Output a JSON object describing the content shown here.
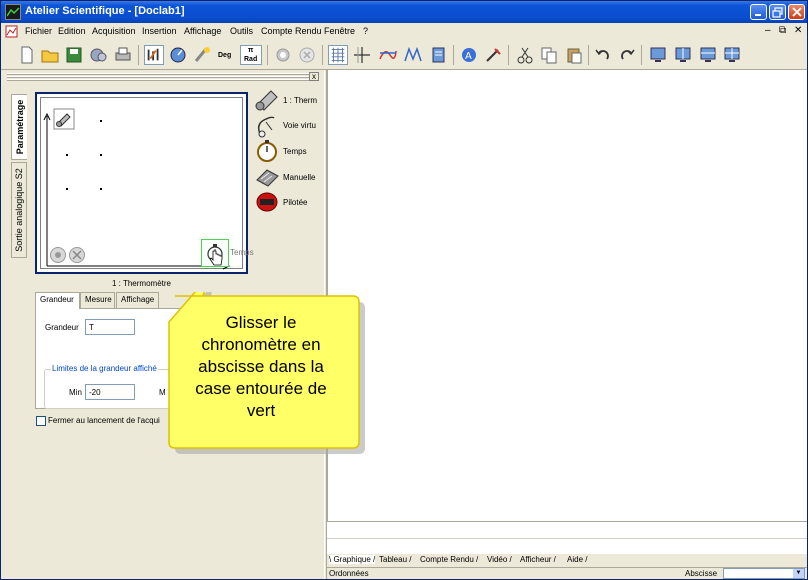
{
  "window": {
    "title": "Atelier Scientifique - [Doclab1]"
  },
  "menubar": {
    "items": [
      "Fichier",
      "Edition",
      "Acquisition",
      "Insertion",
      "Affichage",
      "Outils",
      "Compte Rendu",
      "Fenêtre",
      "?"
    ],
    "mdi_controls": [
      "–",
      "⧉",
      "✕"
    ]
  },
  "toolbar": {
    "deg_label": "Deg",
    "pi_label": "π",
    "rad_label": "Rad"
  },
  "left_panel": {
    "vertical_tabs": [
      "Paramétrage",
      "Sortie analogique S2"
    ],
    "sensors": [
      {
        "label": "1 : Therm",
        "icon": "thermometer-icon"
      },
      {
        "label": "Voie virtu",
        "icon": "virtual-channel-icon"
      },
      {
        "label": "Temps",
        "icon": "stopwatch-icon"
      },
      {
        "label": "Manuelle",
        "icon": "keyboard-icon"
      },
      {
        "label": "Pilotée",
        "icon": "piloted-icon"
      }
    ],
    "graph": {
      "x_drop_label": "Temps",
      "caption": "1 : Thermomètre"
    },
    "tabs": [
      "Grandeur",
      "Mesure",
      "Affichage"
    ],
    "active_tab": "Grandeur",
    "grandeur_label": "Grandeur",
    "grandeur_value": "T",
    "limits_title": "Limites de la grandeur affiché",
    "min_label": "Min",
    "min_value": "-20",
    "max_label_fragment": "M",
    "close_on_start_label": "Fermer au lancement de l'acqui"
  },
  "callout": {
    "text_lines": [
      "Glisser le",
      "chronomètre en",
      "abscisse dans la",
      "case entourée de",
      "vert"
    ],
    "color": "#ffff66"
  },
  "bottom_tabs": [
    "Graphique",
    "Tableau",
    "Compte Rendu",
    "Vidéo",
    "Afficheur",
    "Aide"
  ],
  "status": {
    "ordonnees": "Ordonnées",
    "abscisse": "Abscisse"
  }
}
